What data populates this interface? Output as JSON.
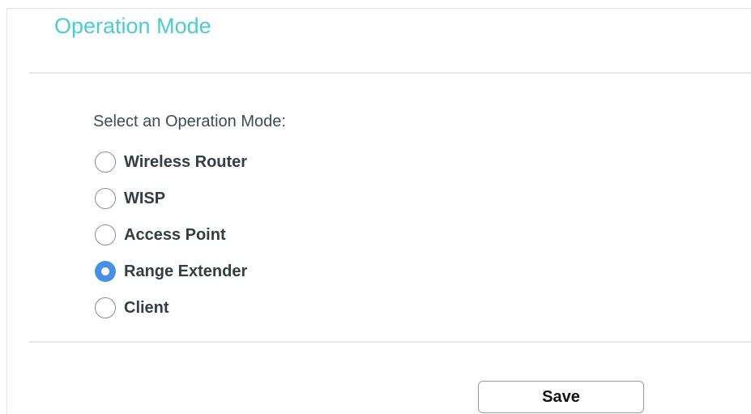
{
  "page": {
    "title": "Operation Mode",
    "title_color": "#4acbd6"
  },
  "operation_mode": {
    "label": "Select an Operation Mode:",
    "selected": "Range Extender",
    "accent_color": "#4a90e2",
    "options": [
      {
        "label": "Wireless Router",
        "checked": false
      },
      {
        "label": "WISP",
        "checked": false
      },
      {
        "label": "Access Point",
        "checked": false
      },
      {
        "label": "Range Extender",
        "checked": true
      },
      {
        "label": "Client",
        "checked": false
      }
    ]
  },
  "actions": {
    "save_label": "Save"
  }
}
